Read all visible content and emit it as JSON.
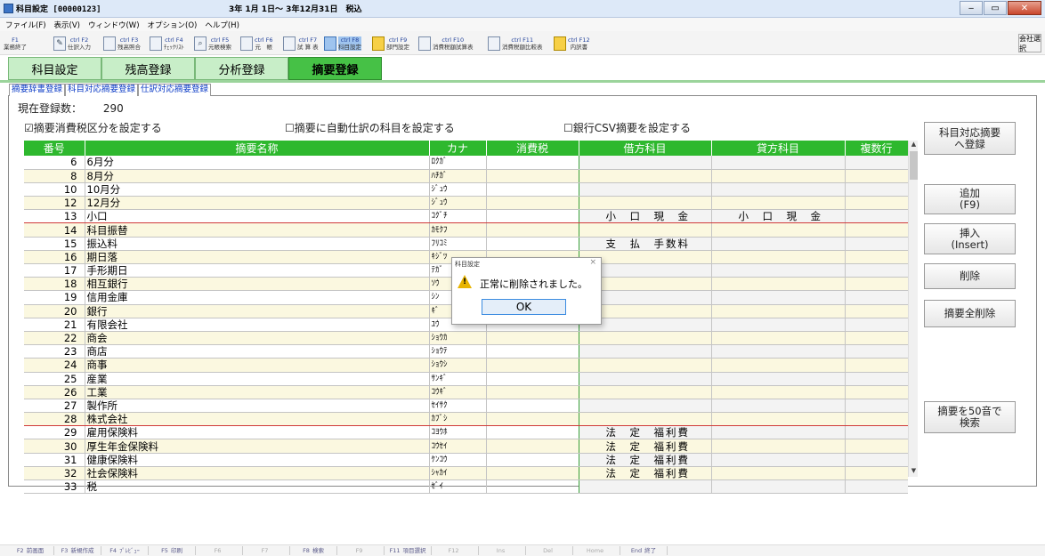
{
  "window": {
    "title": "科目設定 [00000123]",
    "period": "3年 1月 1日～ 3年12月31日　税込",
    "btn_min": "‒",
    "btn_max": "▭",
    "btn_close": "✕"
  },
  "menu": [
    "ファイル(F)",
    "表示(V)",
    "ウィンドウ(W)",
    "オプション(O)",
    "ヘルプ(H)"
  ],
  "toolbar": {
    "items": [
      {
        "key": "F1",
        "label": "業務終了",
        "icon": "exit-icon"
      },
      {
        "key": "ctrl F2",
        "label": "仕訳入力",
        "icon": "pen-icon"
      },
      {
        "key": "ctrl F3",
        "label": "残高照合",
        "icon": "ledger-icon"
      },
      {
        "key": "ctrl F4",
        "label": "ﾁｪｯｸﾘｽﾄ",
        "icon": "checklist-icon"
      },
      {
        "key": "ctrl F5",
        "label": "元帳検索",
        "icon": "search-icon"
      },
      {
        "key": "ctrl F6",
        "label": "元　帳",
        "icon": "book-icon"
      },
      {
        "key": "ctrl F7",
        "label": "試 算 表",
        "icon": "table-icon"
      },
      {
        "key": "ctrl F8",
        "label": "科目設定",
        "icon": "settings-icon"
      },
      {
        "key": "ctrl F9",
        "label": "部門設定",
        "icon": "department-icon"
      },
      {
        "key": "ctrl F10",
        "label": "消費税額試算表",
        "icon": "tax-icon"
      },
      {
        "key": "ctrl F11",
        "label": "消費税額比較表",
        "icon": "compare-icon"
      },
      {
        "key": "ctrl F12",
        "label": "内訳書",
        "icon": "folder-icon"
      }
    ],
    "right_label": "会社選択"
  },
  "main_tabs": [
    "科目設定",
    "残高登録",
    "分析登録",
    "摘要登録"
  ],
  "sub_tabs": [
    "摘要辞書登録",
    "科目対応摘要登録",
    "仕訳対応摘要登録"
  ],
  "count": {
    "label": "現在登録数：",
    "value": "290"
  },
  "options": [
    "☑摘要消費税区分を設定する",
    "☐摘要に自動仕訳の科目を設定する",
    "☐銀行CSV摘要を設定する"
  ],
  "columns": [
    "番号",
    "摘要名称",
    "カナ",
    "消費税",
    "借方科目",
    "貸方科目",
    "複数行"
  ],
  "rows": [
    {
      "no": "6",
      "name": "6月分",
      "kana": "ﾛｸｶﾞ",
      "tax": "",
      "debit": "",
      "credit": "",
      "multi": ""
    },
    {
      "no": "8",
      "name": "8月分",
      "kana": "ﾊﾁｶﾞ",
      "tax": "",
      "debit": "",
      "credit": "",
      "multi": ""
    },
    {
      "no": "10",
      "name": "10月分",
      "kana": "ｼﾞｭｳ",
      "tax": "",
      "debit": "",
      "credit": "",
      "multi": ""
    },
    {
      "no": "12",
      "name": "12月分",
      "kana": "ｼﾞｭｳ",
      "tax": "",
      "debit": "",
      "credit": "",
      "multi": ""
    },
    {
      "no": "13",
      "name": "小口",
      "kana": "ｺｸﾞﾁ",
      "tax": "",
      "debit": "小　口　現　金",
      "credit": "小　口　現　金",
      "multi": ""
    },
    {
      "no": "14",
      "name": "科目振替",
      "kana": "ｶﾓｸﾌ",
      "tax": "",
      "debit": "",
      "credit": "",
      "multi": ""
    },
    {
      "no": "15",
      "name": "振込料",
      "kana": "ﾌﾘｺﾐ",
      "tax": "",
      "debit": "支　払　手数料",
      "credit": "",
      "multi": ""
    },
    {
      "no": "16",
      "name": "期日落",
      "kana": "ｷｼﾞﾂ",
      "tax": "",
      "debit": "",
      "credit": "",
      "multi": ""
    },
    {
      "no": "17",
      "name": "手形期日",
      "kana": "ﾃｶﾞ",
      "tax": "",
      "debit": "",
      "credit": "",
      "multi": ""
    },
    {
      "no": "18",
      "name": "相互銀行",
      "kana": "ｿｳ",
      "tax": "",
      "debit": "",
      "credit": "",
      "multi": ""
    },
    {
      "no": "19",
      "name": "信用金庫",
      "kana": "ｼﾝ",
      "tax": "",
      "debit": "",
      "credit": "",
      "multi": ""
    },
    {
      "no": "20",
      "name": "銀行",
      "kana": "ｷﾞ",
      "tax": "",
      "debit": "",
      "credit": "",
      "multi": ""
    },
    {
      "no": "21",
      "name": "有限会社",
      "kana": "ﾕｳ",
      "tax": "",
      "debit": "",
      "credit": "",
      "multi": ""
    },
    {
      "no": "22",
      "name": "商会",
      "kana": "ｼｮｳｶ",
      "tax": "",
      "debit": "",
      "credit": "",
      "multi": ""
    },
    {
      "no": "23",
      "name": "商店",
      "kana": "ｼｮｳﾃ",
      "tax": "",
      "debit": "",
      "credit": "",
      "multi": ""
    },
    {
      "no": "24",
      "name": "商事",
      "kana": "ｼｮｳｼ",
      "tax": "",
      "debit": "",
      "credit": "",
      "multi": ""
    },
    {
      "no": "25",
      "name": "産業",
      "kana": "ｻﾝｷﾞ",
      "tax": "",
      "debit": "",
      "credit": "",
      "multi": ""
    },
    {
      "no": "26",
      "name": "工業",
      "kana": "ｺｳｷﾞ",
      "tax": "",
      "debit": "",
      "credit": "",
      "multi": ""
    },
    {
      "no": "27",
      "name": "製作所",
      "kana": "ｾｲｻｸ",
      "tax": "",
      "debit": "",
      "credit": "",
      "multi": ""
    },
    {
      "no": "28",
      "name": "株式会社",
      "kana": "ｶﾌﾞｼ",
      "tax": "",
      "debit": "",
      "credit": "",
      "multi": ""
    },
    {
      "no": "29",
      "name": "雇用保険料",
      "kana": "ｺﾖｳﾎ",
      "tax": "",
      "debit": "法　定　福利費",
      "credit": "",
      "multi": ""
    },
    {
      "no": "30",
      "name": "厚生年金保険料",
      "kana": "ｺｳｾｲ",
      "tax": "",
      "debit": "法　定　福利費",
      "credit": "",
      "multi": ""
    },
    {
      "no": "31",
      "name": "健康保険料",
      "kana": "ｹﾝｺｳ",
      "tax": "",
      "debit": "法　定　福利費",
      "credit": "",
      "multi": ""
    },
    {
      "no": "32",
      "name": "社会保険料",
      "kana": "ｼｬｶｲ",
      "tax": "",
      "debit": "法　定　福利費",
      "credit": "",
      "multi": ""
    },
    {
      "no": "33",
      "name": "税",
      "kana": "ｾﾞｲ",
      "tax": "",
      "debit": "",
      "credit": "",
      "multi": ""
    }
  ],
  "right_buttons": {
    "register_to_account": "科目対応摘要\nへ登録",
    "add": "追加\n(F9)",
    "insert": "挿入\n(Insert)",
    "delete": "削除",
    "delete_all": "摘要全削除",
    "search_50": "摘要を50音で\n検索"
  },
  "dialog": {
    "title": "科目設定",
    "close": "×",
    "message": "正常に削除されました。",
    "ok": "OK"
  },
  "footer_keys": [
    {
      "key": "F2",
      "label": "前画面",
      "dim": false
    },
    {
      "key": "F3",
      "label": "新規作成",
      "dim": false
    },
    {
      "key": "F4",
      "label": "ﾌﾟﾚﾋﾞｭｰ",
      "dim": false
    },
    {
      "key": "F5",
      "label": "印刷",
      "dim": false
    },
    {
      "key": "F6",
      "label": "",
      "dim": true
    },
    {
      "key": "F7",
      "label": "",
      "dim": true
    },
    {
      "key": "F8",
      "label": "検索",
      "dim": false
    },
    {
      "key": "F9",
      "label": "",
      "dim": true
    },
    {
      "key": "F11",
      "label": "項目選択",
      "dim": false
    },
    {
      "key": "F12",
      "label": "",
      "dim": true
    },
    {
      "key": "Ins",
      "label": "",
      "dim": true
    },
    {
      "key": "Del",
      "label": "",
      "dim": true
    },
    {
      "key": "Home",
      "label": "",
      "dim": true
    },
    {
      "key": "End",
      "label": "終了",
      "dim": false
    }
  ]
}
